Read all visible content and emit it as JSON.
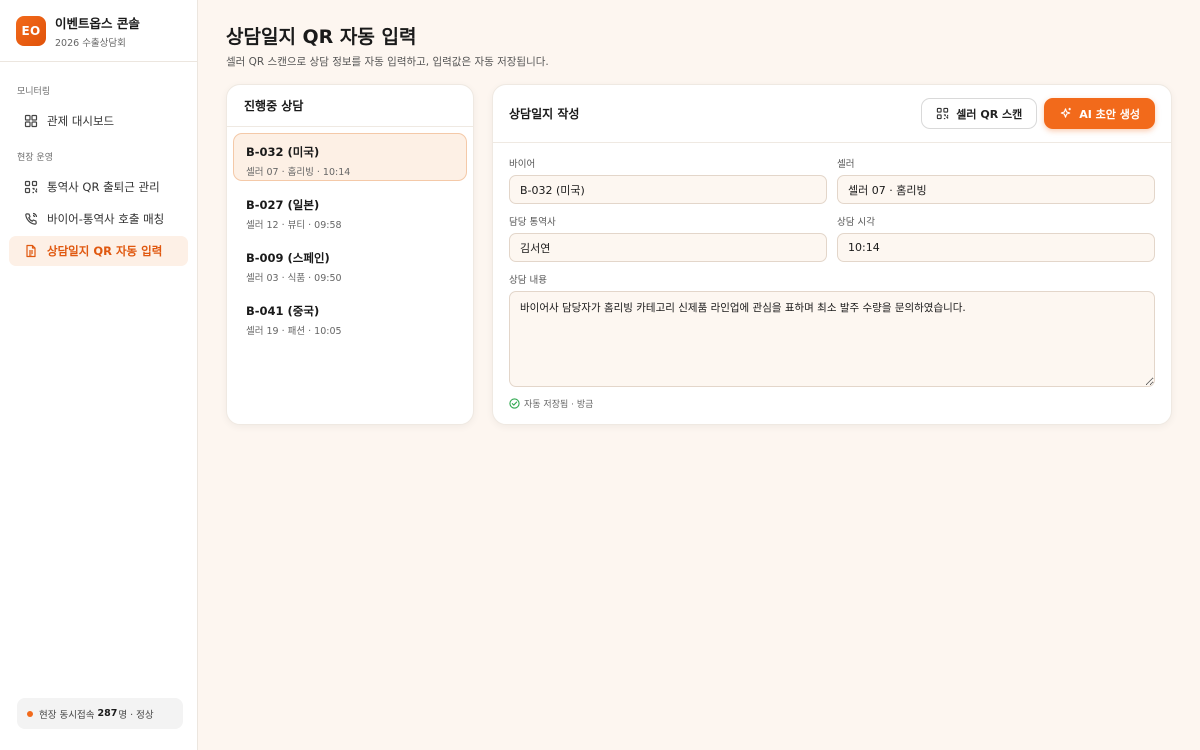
{
  "brand": {
    "logo": "EO",
    "title": "이벤트옵스 콘솔",
    "subtitle": "2026 수출상담회"
  },
  "sidebar": {
    "sections": [
      {
        "label": "모니터링"
      },
      {
        "label": "현장 운영"
      }
    ],
    "items": [
      {
        "label": "관제 대시보드",
        "icon": "grid-icon"
      },
      {
        "label": "통역사 QR 출퇴근 관리",
        "icon": "qr-icon"
      },
      {
        "label": "바이어-통역사 호출 매칭",
        "icon": "phone-icon"
      },
      {
        "label": "상담일지 QR 자동 입력",
        "icon": "document-icon",
        "active": true
      }
    ],
    "status": {
      "prefix": "현장 동시접속",
      "count": "287",
      "suffix": "명 · 정상",
      "dot_color": "#f26a1b"
    }
  },
  "page": {
    "title": "상담일지 QR 자동 입력",
    "subtitle": "셀러 QR 스캔으로 상담 정보를 자동 입력하고, 입력값은 자동 저장됩니다."
  },
  "sessions": {
    "title": "진행중 상담",
    "items": [
      {
        "title": "B-032 (미국)",
        "sub": "셀러 07 · 홈리빙 · 10:14",
        "selected": true
      },
      {
        "title": "B-027 (일본)",
        "sub": "셀러 12 · 뷰티 · 09:58"
      },
      {
        "title": "B-009 (스페인)",
        "sub": "셀러 03 · 식품 · 09:50"
      },
      {
        "title": "B-041 (중국)",
        "sub": "셀러 19 · 패션 · 10:05"
      }
    ]
  },
  "form": {
    "title": "상담일지 작성",
    "scan_button": "셀러 QR 스캔",
    "ai_button": "AI 초안 생성",
    "buyer_label": "바이어",
    "buyer_value": "B-032 (미국)",
    "seller_label": "셀러",
    "seller_value": "셀러 07 · 홈리빙",
    "interpreter_label": "담당 통역사",
    "interpreter_value": "김서연",
    "time_label": "상담 시각",
    "time_value": "10:14",
    "content_label": "상담 내용",
    "content_value": "바이어사 담당자가 홈리빙 카테고리 신제품 라인업에 관심을 표하며 최소 발주 수량을 문의하였습니다.",
    "saved_text": "자동 저장됨 · 방금"
  },
  "colors": {
    "accent": "#f26a1b",
    "success": "#2fa84f"
  }
}
